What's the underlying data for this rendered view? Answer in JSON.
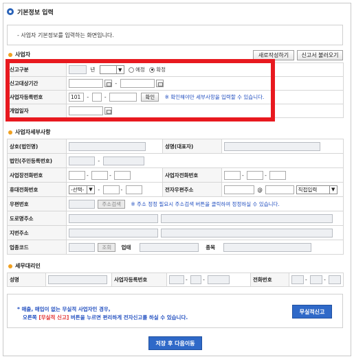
{
  "header": {
    "title": "기본정보 입력",
    "description": "- 사업자 기본정보를 입력하는 화면입니다."
  },
  "business": {
    "section_title": "사업자",
    "new_write_button": "새로작성하기",
    "load_report_button": "신고서 불러오기",
    "report_type_label": "신고구분",
    "report_type_year_unit": "년",
    "report_type_radio_scheduled": "예정",
    "report_type_radio_final": "확정",
    "period_label": "신고대상기간",
    "reg_no_label": "사업자등록번호",
    "reg_no_prefix": "101",
    "confirm_button": "확인",
    "reg_no_note": "※ 확인해야만 세부사항을 입력할 수 있습니다.",
    "open_date_label": "개업일자"
  },
  "detail": {
    "section_title": "사업자세부사항",
    "company_label": "상호(법인명)",
    "rep_label": "성명(대표자)",
    "corp_no_label": "법인(주민등록번호)",
    "biz_phone_label": "사업장전화번호",
    "biz_phone2_label": "사업자전화번호",
    "mobile_label": "휴대전화번호",
    "mobile_select": "-선택-",
    "email_label": "전자우편주소",
    "email_at": "@",
    "email_domain_select": "직접입력",
    "postal_label": "우편번호",
    "address_search_button": "주소검색",
    "postal_note": "※ 주소 정정 필요시 주소검색 버튼을 클릭하여 정정하실 수 있습니다.",
    "road_address_label": "도로명주소",
    "lot_address_label": "지번주소",
    "industry_code_label": "업종코드",
    "lookup_button": "조회",
    "business_type_label": "업태",
    "item_label": "종목"
  },
  "agent": {
    "section_title": "세무대리인",
    "name_label": "성명",
    "reg_no_label": "사업자등록번호",
    "phone_label": "전화번호"
  },
  "notice": {
    "line1": "* 매출, 매입이 없는 무실적 사업자인 경우,",
    "line2_prefix": "오른쪽 ",
    "line2_highlight": "[무실적 신고]",
    "line2_suffix": " 버튼을 누르면 편리하게 전자신고를 하실 수 있습니다.",
    "no_performance_button": "무실적신고"
  },
  "footer": {
    "save_next_button": "저장 후 다음이동"
  },
  "colors": {
    "accent_blue": "#2f69c8",
    "highlight_red": "#e8191f",
    "section_dot": "#f0a020"
  }
}
